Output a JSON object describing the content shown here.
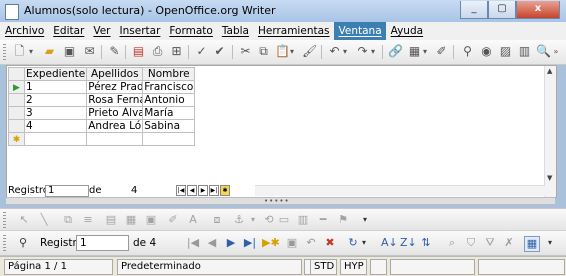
{
  "window": {
    "title": "Alumnos(solo lectura) - OpenOffice.org Writer",
    "controls": [
      "_",
      "▢",
      "x"
    ]
  },
  "menu": {
    "items": [
      "Archivo",
      "Editar",
      "Ver",
      "Insertar",
      "Formato",
      "Tabla",
      "Herramientas",
      "Ventana",
      "Ayuda"
    ],
    "active": "Ventana"
  },
  "table": {
    "columns": [
      "Expediente",
      "Apellidos",
      "Nombre"
    ],
    "rows": [
      {
        "expediente": "1",
        "apellidos": "Pérez Prados",
        "nombre": "Francisco"
      },
      {
        "expediente": "2",
        "apellidos": "Rosa Fernánd",
        "nombre": "Antonio"
      },
      {
        "expediente": "3",
        "apellidos": "Prieto Álvarez",
        "nombre": "María"
      },
      {
        "expediente": "4",
        "apellidos": "Andrea Lópe:",
        "nombre": "Sabina"
      }
    ],
    "current_row_marker": "▶",
    "new_row_marker": "✱"
  },
  "grid_nav": {
    "label": "Registro",
    "value": "1",
    "of_label": "de",
    "count": "4"
  },
  "form_nav": {
    "label": "Registro",
    "value": "1",
    "of_text": "de 4"
  },
  "status": {
    "page": "Página  1 / 1",
    "style": "Predeterminado",
    "mode_std": "STD",
    "mode_hyp": "HYP"
  }
}
